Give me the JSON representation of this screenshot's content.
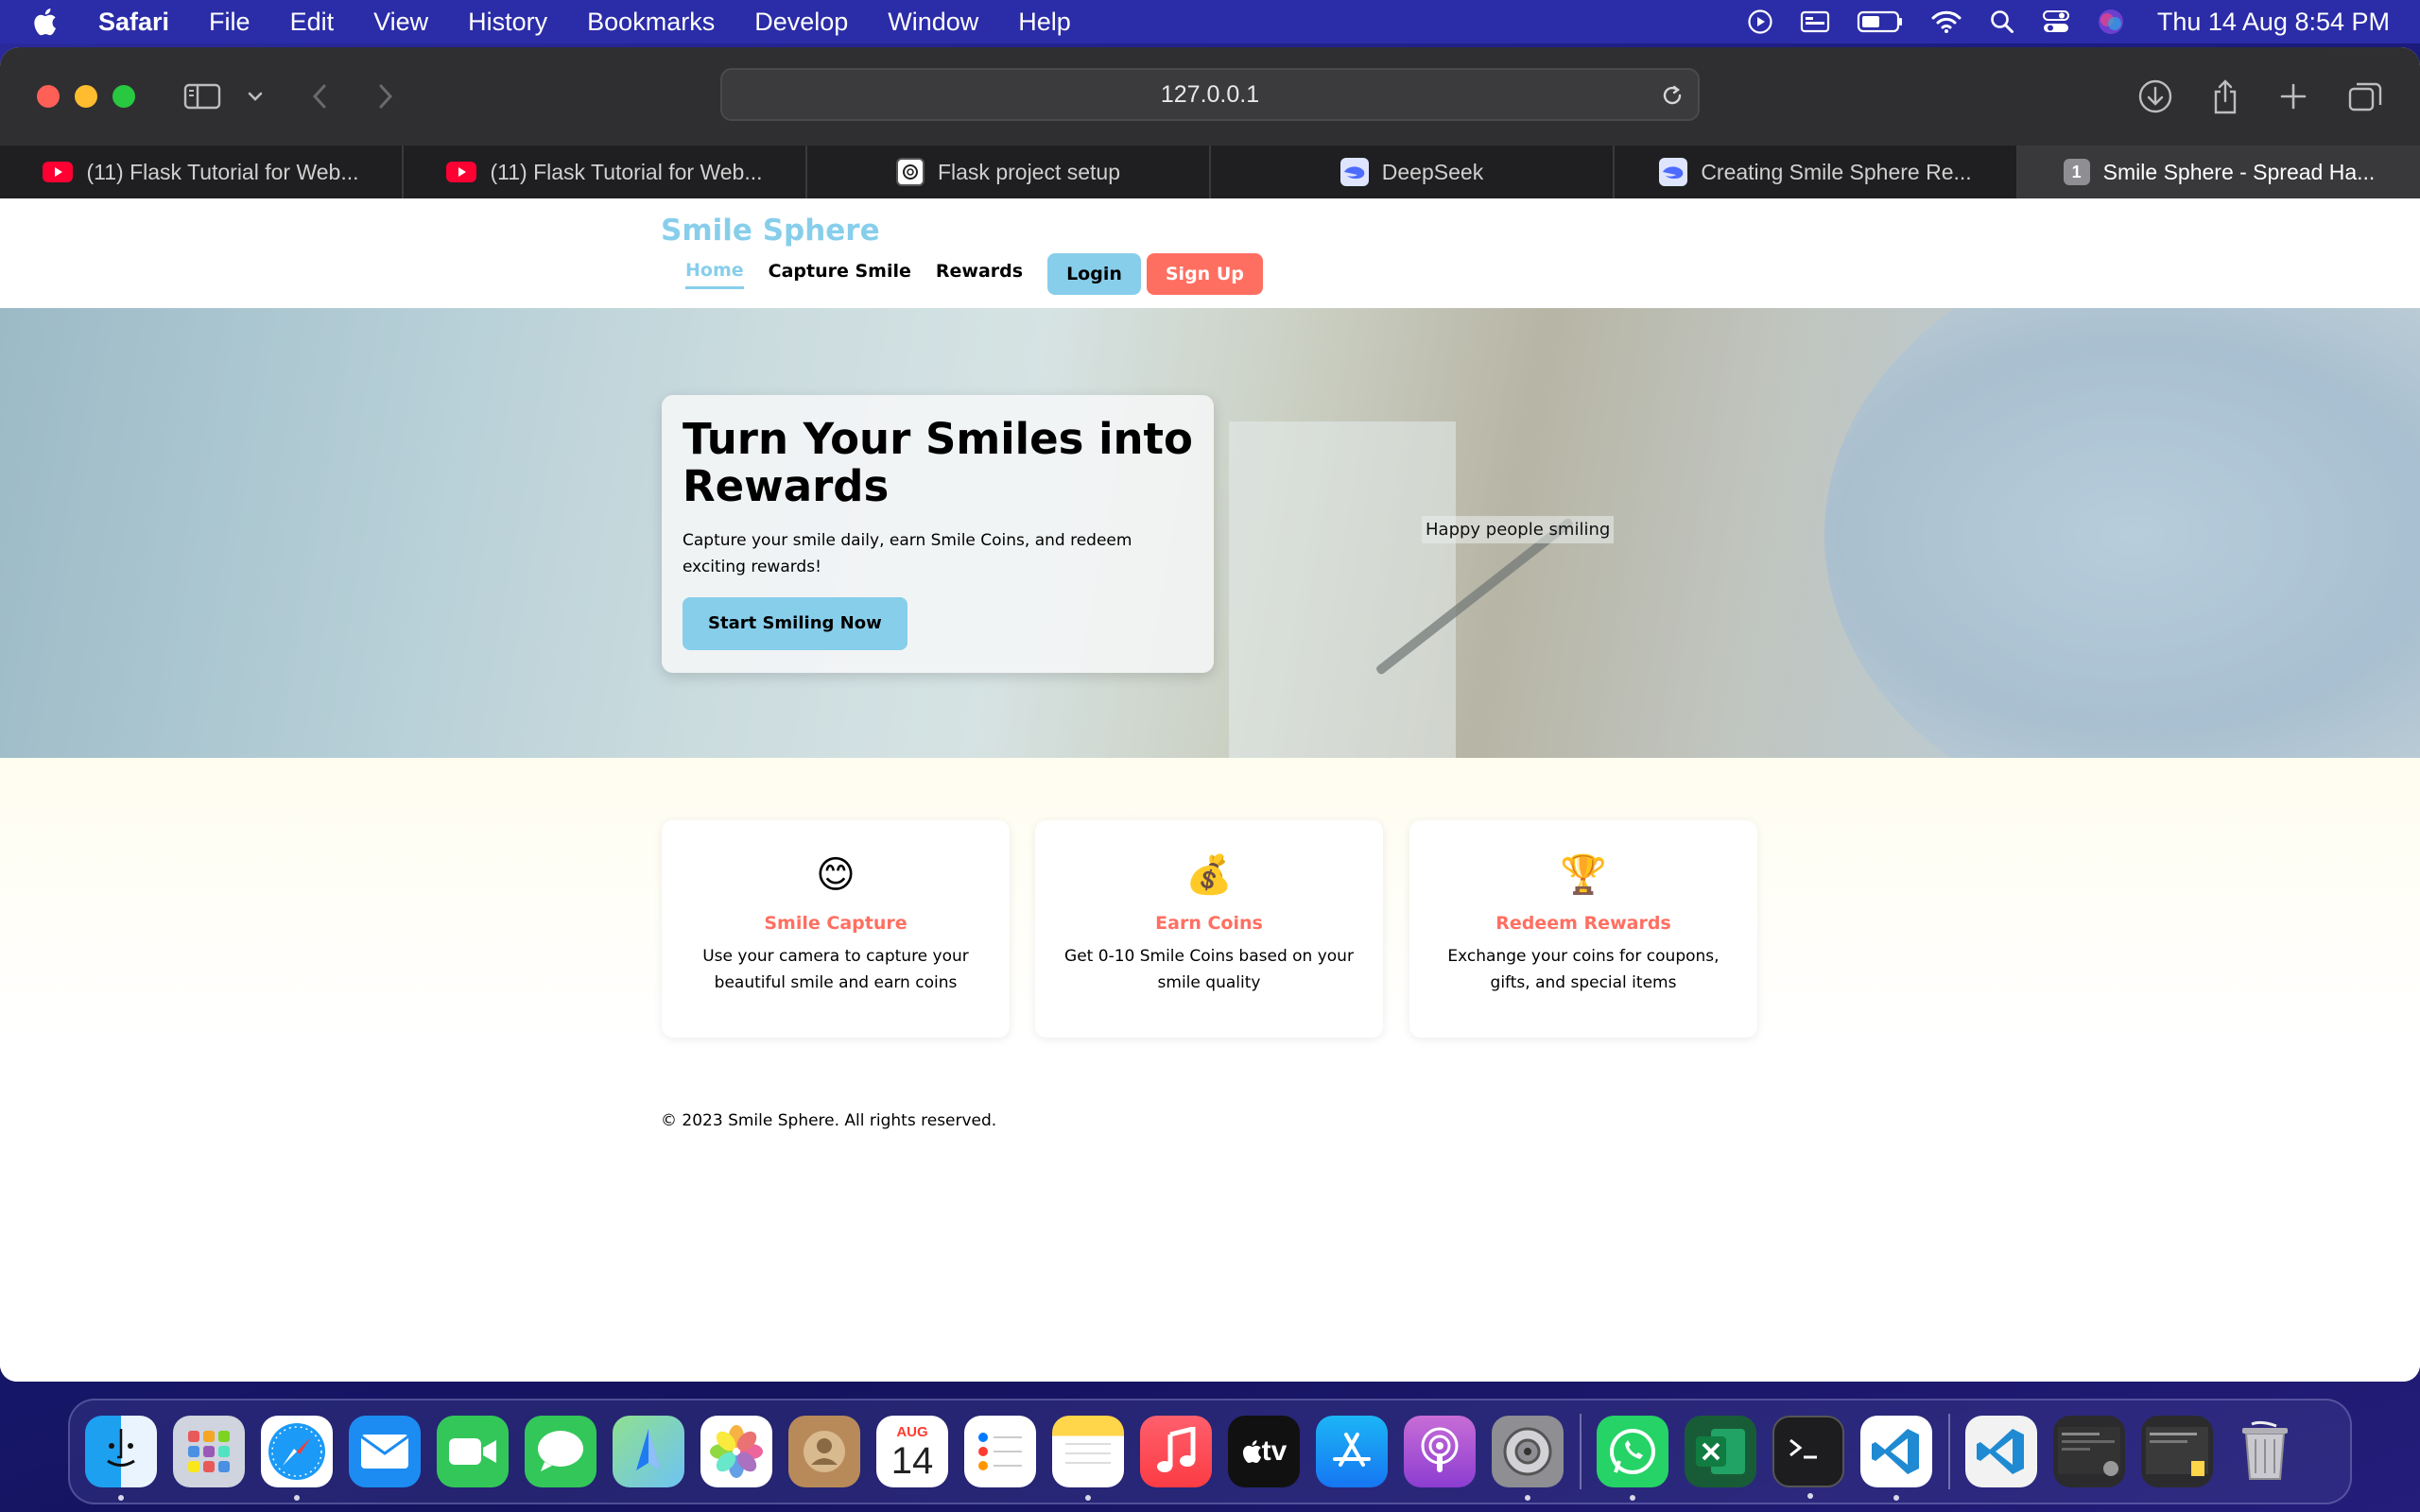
{
  "menubar": {
    "app": "Safari",
    "items": [
      "File",
      "Edit",
      "View",
      "History",
      "Bookmarks",
      "Develop",
      "Window",
      "Help"
    ],
    "clock": "Thu 14 Aug  8:54 PM"
  },
  "browser": {
    "url": "127.0.0.1",
    "tabs": [
      {
        "title": "(11) Flask Tutorial for Web...",
        "icon": "youtube-icon"
      },
      {
        "title": "(11) Flask Tutorial for Web...",
        "icon": "youtube-icon"
      },
      {
        "title": "Flask project setup",
        "icon": "chatgpt-icon"
      },
      {
        "title": "DeepSeek",
        "icon": "deepseek-icon"
      },
      {
        "title": "Creating Smile Sphere Re...",
        "icon": "deepseek-icon"
      },
      {
        "title": "Smile Sphere - Spread Ha...",
        "icon": "tab-number-icon",
        "badge": "1",
        "active": true
      }
    ]
  },
  "site": {
    "brand": "Smile Sphere",
    "nav": {
      "home": "Home",
      "capture": "Capture Smile",
      "rewards": "Rewards",
      "login": "Login",
      "signup": "Sign Up"
    },
    "hero": {
      "title": "Turn Your Smiles into Rewards",
      "text": "Capture your smile daily, earn Smile Coins, and redeem exciting rewards!",
      "cta": "Start Smiling Now",
      "image_alt": "Happy people smiling"
    },
    "features": [
      {
        "emoji": "😊",
        "title": "Smile Capture",
        "text": "Use your camera to capture your beautiful smile and earn coins"
      },
      {
        "emoji": "💰",
        "title": "Earn Coins",
        "text": "Get 0-10 Smile Coins based on your smile quality"
      },
      {
        "emoji": "🏆",
        "title": "Redeem Rewards",
        "text": "Exchange your coins for coupons, gifts, and special items"
      }
    ],
    "footer": "© 2023 Smile Sphere. All rights reserved."
  },
  "dock": {
    "calendar": {
      "month": "AUG",
      "day": "14"
    },
    "tv_label": "tv"
  },
  "colors": {
    "brand": "#87ceeb",
    "accent": "#ff6f61",
    "menubar": "#2b2ca8"
  }
}
